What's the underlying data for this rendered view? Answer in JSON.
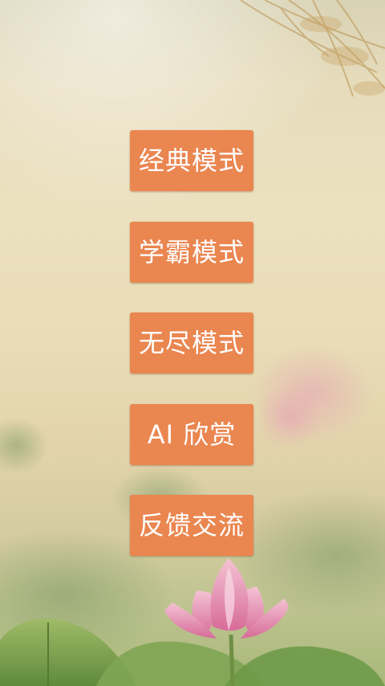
{
  "menu": {
    "items": [
      {
        "id": "classic",
        "label": "经典模式"
      },
      {
        "id": "scholar",
        "label": "学霸模式"
      },
      {
        "id": "endless",
        "label": "无尽模式"
      },
      {
        "id": "ai",
        "label": "AI 欣赏"
      },
      {
        "id": "feedback",
        "label": "反馈交流"
      }
    ],
    "button_color": "#ea8650",
    "text_color": "#ffffff"
  },
  "background": {
    "icons": [
      "lotus-flower-icon",
      "lotus-leaf-icon",
      "reed-grass-icon"
    ],
    "palette": [
      "#ece1bf",
      "#a8b87a",
      "#e58fb0"
    ]
  }
}
